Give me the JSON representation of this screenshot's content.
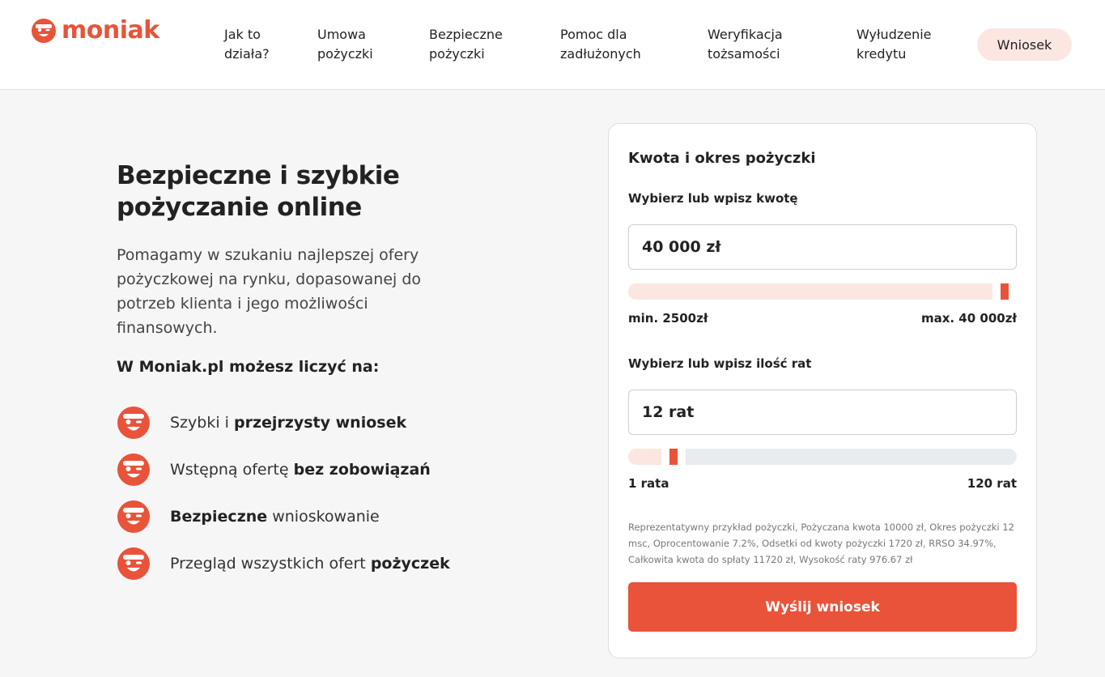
{
  "brand": {
    "name": "moniak",
    "color": "#e8533a",
    "logo_icon": "smiley-face-icon"
  },
  "nav": {
    "items": [
      {
        "label": "Jak to\ndziała?"
      },
      {
        "label": "Umowa\npożyczki"
      },
      {
        "label": "Bezpieczne\npożyczki"
      },
      {
        "label": "Pomoc dla\nzadłużonych"
      },
      {
        "label": "Weryfikacja\ntożsamości"
      },
      {
        "label": "Wyłudzenie\nkredytu"
      }
    ],
    "cta": "Wniosek"
  },
  "hero": {
    "title": "Bezpieczne i szybkie pożyczanie online",
    "description": "Pomagamy w szukaniu najlepszej ofery pożyczkowej na rynku, dopasowanej do potrzeb klienta i jego możliwości finansowych.",
    "features_heading": "W Moniak.pl możesz liczyć na:",
    "features": [
      {
        "pre": "Szybki i ",
        "bold": "przejrzysty wniosek",
        "post": ""
      },
      {
        "pre": "Wstępną ofertę ",
        "bold": "bez zobowiązań",
        "post": ""
      },
      {
        "pre": "",
        "bold": "Bezpieczne",
        "post": " wnioskowanie"
      },
      {
        "pre": "Przegląd wszystkich ofert ",
        "bold": "pożyczek",
        "post": ""
      }
    ]
  },
  "form": {
    "title": "Kwota i okres pożyczki",
    "amount": {
      "label": "Wybierz lub wpisz kwotę",
      "value": "40 000 zł",
      "min_label": "min. 2500zł",
      "max_label": "max. 40 000zł",
      "slider_fraction": 1.0
    },
    "installments": {
      "label": "Wybierz lub wpisz ilość rat",
      "value": "12 rat",
      "min_label": "1 rata",
      "max_label": "120 rat",
      "slider_fraction": 0.092
    },
    "disclaimer": "Reprezentatywny przykład pożyczki, Pożyczana kwota 10000 zł, Okres pożyczki 12 msc, Oprocentowanie 7.2%, Odsetki od kwoty pożyczki 1720 zł, RRSO 34.97%, Całkowita kwota do spłaty 11720 zł, Wysokość raty 976.67 zł",
    "submit_label": "Wyślij wniosek"
  }
}
